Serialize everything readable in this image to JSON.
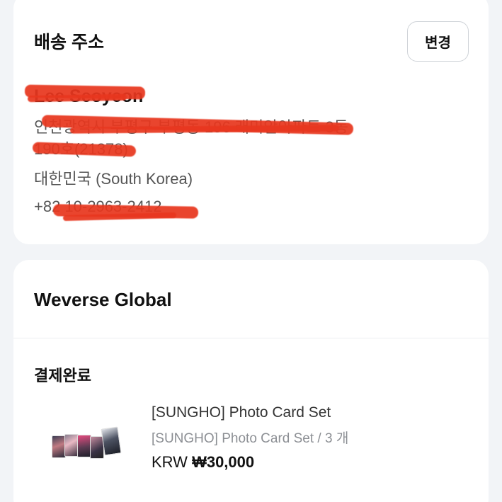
{
  "address": {
    "title": "배송 주소",
    "change_label": "변경",
    "name": "Lee Seoyeon",
    "line1": "인천광역시 부평구 부평동 196 래미안아파트 3동",
    "line2": "190호(21378)",
    "country": "대한민국 (South Korea)",
    "phone": "+82 10-2963-2412"
  },
  "order": {
    "store": "Weverse Global",
    "status": "결제완료",
    "item": {
      "title": "[SUNGHO] Photo Card Set",
      "option": "[SUNGHO] Photo Card Set / 3 개",
      "currency": "KRW",
      "price": "₩30,000"
    }
  },
  "colors": {
    "background": "#f2f4f7",
    "card": "#ffffff",
    "redaction": "#e8371f"
  }
}
